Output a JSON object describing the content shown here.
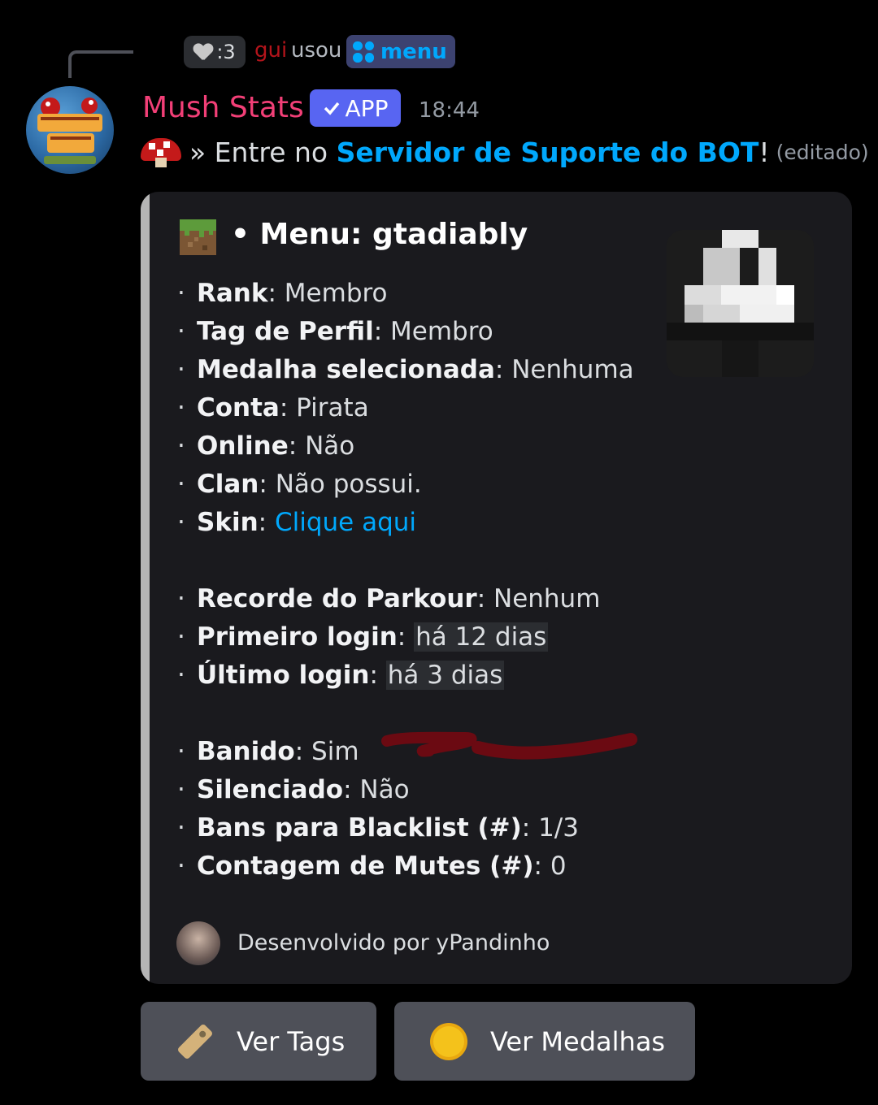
{
  "command_reply": {
    "avatar_text": ":3",
    "user": "gui",
    "used_text": "usou",
    "command": "menu"
  },
  "message": {
    "bot_name": "Mush Stats",
    "app_badge": "APP",
    "timestamp": "18:44",
    "prefix": "» Entre no ",
    "link_text": "Servidor de Suporte do BOT",
    "suffix": "!",
    "edited": "(editado)"
  },
  "embed": {
    "title": "• Menu: gtadiably",
    "fields": [
      {
        "label": "Rank",
        "value": "Membro"
      },
      {
        "label": "Tag de Perfil",
        "value": "Membro"
      },
      {
        "label": "Medalha selecionada",
        "value": "Nenhuma"
      },
      {
        "label": "Conta",
        "value": "Pirata"
      },
      {
        "label": "Online",
        "value": "Não"
      },
      {
        "label": "Clan",
        "value": "Não possui."
      },
      {
        "label": "Skin",
        "value": "Clique aqui"
      },
      {
        "label": "Recorde do Parkour",
        "value": "Nenhum"
      },
      {
        "label": "Primeiro login",
        "value": "há 12 dias"
      },
      {
        "label": "Último login",
        "value": "há 3 dias"
      },
      {
        "label": "Banido",
        "value": "Sim"
      },
      {
        "label": "Silenciado",
        "value": "Não"
      },
      {
        "label": "Bans para Blacklist (#)",
        "value": "1/3"
      },
      {
        "label": "Contagem de Mutes (#)",
        "value": "0"
      }
    ],
    "footer": "Desenvolvido por yPandinho"
  },
  "buttons": {
    "tags": "Ver Tags",
    "medals": "Ver Medalhas"
  },
  "colors": {
    "bot_name": "#f23f77",
    "link": "#00a8fc",
    "app_badge": "#5865f2",
    "embed_bar": "#b5b5b5",
    "button_bg": "#4e5058"
  },
  "icons": [
    "heart-icon",
    "slash-command-icon",
    "mushroom-icon",
    "grass-block-icon",
    "tag-icon",
    "medal-icon",
    "checkmark-icon"
  ]
}
